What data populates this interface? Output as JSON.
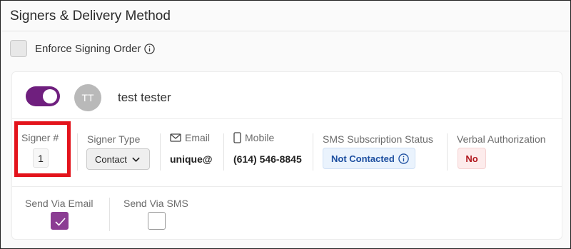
{
  "header": {
    "title": "Signers & Delivery Method"
  },
  "enforce": {
    "label": "Enforce Signing Order",
    "checked": false,
    "icon": "info-icon"
  },
  "signer": {
    "toggle_on": true,
    "avatar_initials": "TT",
    "name": "test tester",
    "columns": {
      "signer_number": {
        "label": "Signer #",
        "value": "1"
      },
      "signer_type": {
        "label": "Signer Type",
        "value": "Contact"
      },
      "email": {
        "label": "Email",
        "value": "unique@",
        "icon": "envelope-icon"
      },
      "mobile": {
        "label": "Mobile",
        "value": "(614) 546-8845",
        "icon": "phone-icon"
      },
      "sms_status": {
        "label": "SMS Subscription Status",
        "value": "Not Contacted",
        "icon": "info-icon"
      },
      "verbal_auth": {
        "label": "Verbal Authorization",
        "value": "No"
      }
    },
    "delivery": {
      "email": {
        "label": "Send Via Email",
        "checked": true
      },
      "sms": {
        "label": "Send Via SMS",
        "checked": false
      }
    }
  },
  "colors": {
    "accent_purple": "#6f1f7e",
    "checkbox_purple": "#8b3d93",
    "highlight_red": "#e3131b",
    "badge_blue_text": "#1d4fa0",
    "badge_red_text": "#b1171d"
  }
}
